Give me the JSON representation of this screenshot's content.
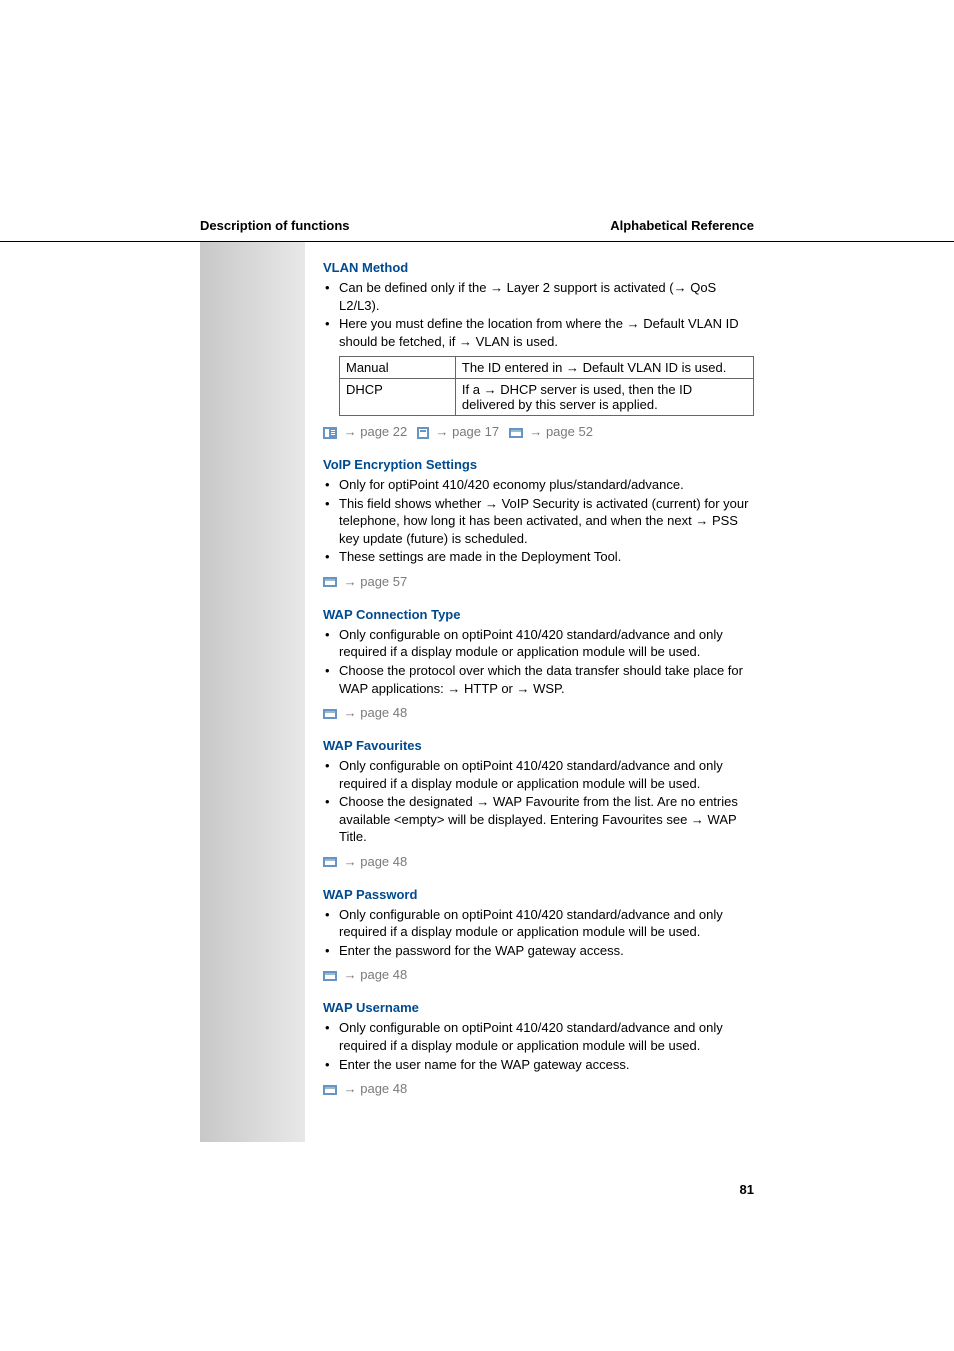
{
  "header": {
    "left": "Description of functions",
    "right": "Alphabetical Reference"
  },
  "sections": {
    "vlan": {
      "title": "VLAN Method",
      "b1a": "Can be defined only if the ",
      "b1b": " Layer 2 support is activated (",
      "b1c": " QoS L2/L3).",
      "b2a": "Here you must define the location from where the ",
      "b2b": " Default VLAN ID should be fetched, if ",
      "b2c": " VLAN is used.",
      "table": {
        "r1c1": "Manual",
        "r1c2a": "The ID entered in ",
        "r1c2b": " Default VLAN ID is used.",
        "r2c1": "DHCP",
        "r2c2a": "If a ",
        "r2c2b": " DHCP server is used, then the ID delivered by this server is applied."
      },
      "ref1": " page 22",
      "ref2": " page 17",
      "ref3": " page 52"
    },
    "voip": {
      "title": "VoIP Encryption Settings",
      "b1": "Only for optiPoint 410/420 economy plus/standard/advance.",
      "b2a": "This field shows whether ",
      "b2b": " VoIP Security is activated (current) for your telephone, how long it has been activated, and when the next ",
      "b2c": " PSS key update (future) is scheduled.",
      "b3": "These settings are made in the Deployment Tool.",
      "ref1": " page 57"
    },
    "wapconn": {
      "title": "WAP Connection Type",
      "b1": "Only configurable on optiPoint 410/420 standard/advance and only required if a display module or application module will be used.",
      "b2a": "Choose the protocol over which the data transfer should take place for WAP applications: ",
      "b2b": " HTTP or ",
      "b2c": " WSP.",
      "ref1": " page 48"
    },
    "wapfav": {
      "title": "WAP Favourites",
      "b1": "Only configurable on optiPoint 410/420 standard/advance and only required if a display module or application module will be used.",
      "b2a": "Choose the designated ",
      "b2b": " WAP Favourite from the list. Are no entries available <empty> will be displayed. Entering Favourites see ",
      "b2c": " WAP Title.",
      "ref1": " page 48"
    },
    "wappw": {
      "title": "WAP Password",
      "b1": "Only configurable on optiPoint 410/420 standard/advance and only required if a display module or application module will be used.",
      "b2": "Enter the password for the WAP gateway access.",
      "ref1": " page 48"
    },
    "wapuser": {
      "title": "WAP Username",
      "b1": "Only configurable on optiPoint 410/420 standard/advance and only required if a display module or application module will be used.",
      "b2": "Enter the user name for the WAP gateway access.",
      "ref1": " page 48"
    }
  },
  "pagenum": "81"
}
